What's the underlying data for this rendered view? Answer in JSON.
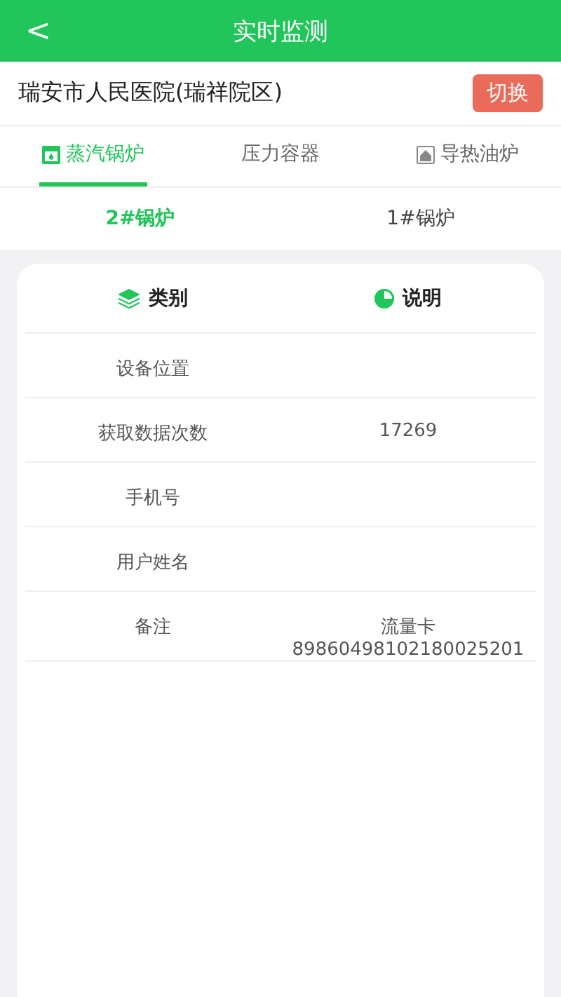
{
  "header": {
    "back": "<",
    "title": "实时监测"
  },
  "site": {
    "name": "瑞安市人民医院(瑞祥院区)",
    "switch_button": "切换"
  },
  "tabs": [
    {
      "label": "蒸汽锅炉",
      "selected": true
    },
    {
      "label": "压力容器",
      "selected": false
    },
    {
      "label": "导热油炉",
      "selected": false
    }
  ],
  "subtabs": [
    {
      "label": "2#锅炉",
      "selected": true
    },
    {
      "label": "1#锅炉",
      "selected": false
    }
  ],
  "table": {
    "columns": [
      "类别",
      "说明"
    ],
    "rows": [
      {
        "label": "设备位置"
      },
      {
        "label": "获取数据次数",
        "value": "17269"
      },
      {
        "label": "手机号"
      },
      {
        "label": "用户姓名"
      },
      {
        "label": "备注",
        "value": "流量卡 89860498102180025201"
      }
    ]
  }
}
